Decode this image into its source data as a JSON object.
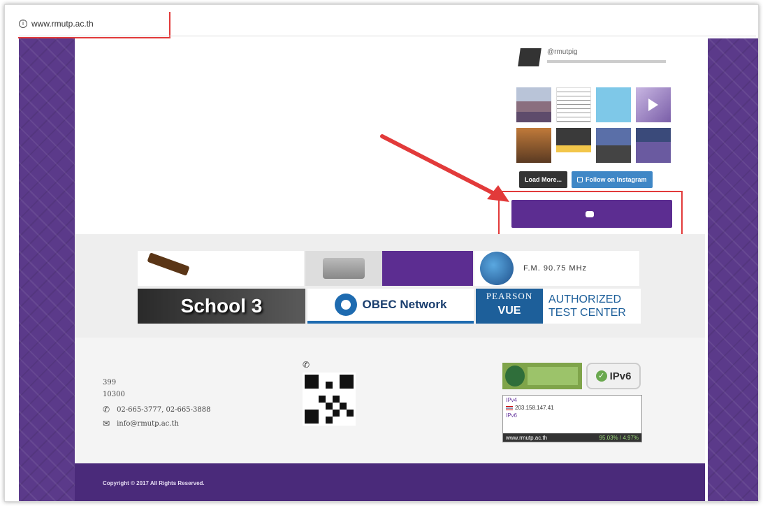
{
  "browser": {
    "url": "www.rmutp.ac.th"
  },
  "instagram": {
    "handle": "@rmutpig",
    "load_more_label": "Load More...",
    "follow_label": "Follow on Instagram"
  },
  "complaint_button": {
    "label": ""
  },
  "banners": [
    {
      "id": "procurement",
      "text": ""
    },
    {
      "id": "recruitment",
      "text": ""
    },
    {
      "id": "radio",
      "text": "F.M. 90.75 MHz"
    },
    {
      "id": "school3",
      "text": "School 3"
    },
    {
      "id": "obec",
      "text": "OBEC Network"
    },
    {
      "id": "pearson",
      "text_top": "PEARSON",
      "text_bottom": "VUE",
      "text_right1": "AUTHORIZED",
      "text_right2": "TEST CENTER"
    }
  ],
  "footer": {
    "university": "",
    "address": "399",
    "address_line2": "10300",
    "phone_label": "",
    "phone": "02-665-3777, 02-665-3888",
    "email_label": "",
    "email": "info@rmutp.ac.th",
    "tel_search_label": "",
    "ipv6_label": "IPv6",
    "ipv4_label": "IPv4",
    "ipv4_addr": "203.158.147.41",
    "ipv6_box_label": "IPv6",
    "site_label": "www.rmutp.ac.th",
    "stats": "95.03% / 4.97%"
  },
  "copyright": "Copyright © 2017 All Rights Reserved.",
  "colors": {
    "purple": "#5c2d91",
    "highlight_red": "#e23a3a",
    "instagram_blue": "#3f87c6"
  }
}
